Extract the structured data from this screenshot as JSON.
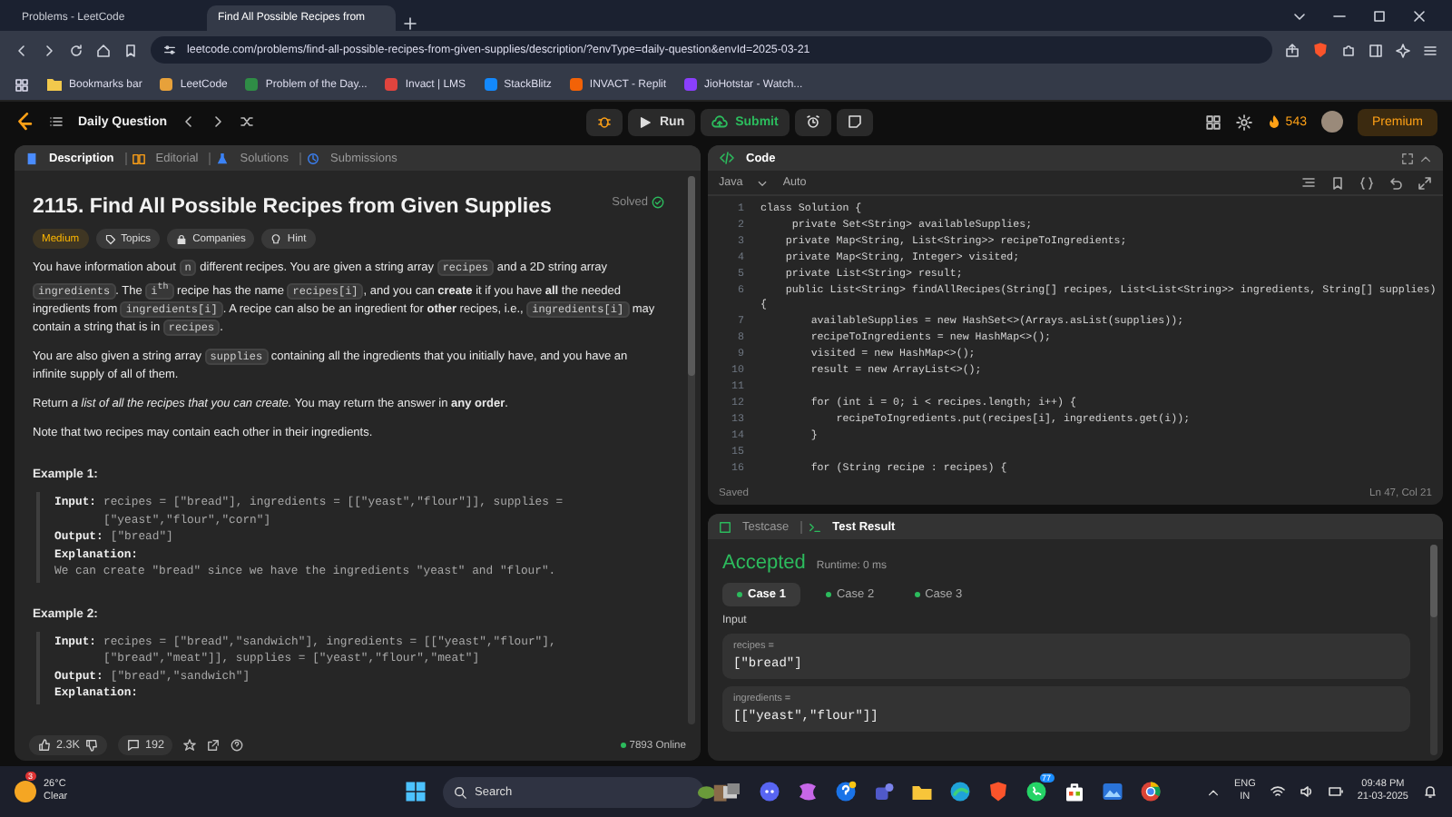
{
  "browser": {
    "tabs": [
      {
        "title": "Problems - LeetCode",
        "selected": false
      },
      {
        "title": "Find All Possible Recipes from",
        "selected": true
      }
    ],
    "url": "leetcode.com/problems/find-all-possible-recipes-from-given-supplies/description/?envType=daily-question&envId=2025-03-21",
    "bookmarks": [
      {
        "label": "Bookmarks bar",
        "kind": "folder",
        "color": "#f2c94c"
      },
      {
        "label": "LeetCode",
        "kind": "site",
        "color": "#e7a13a"
      },
      {
        "label": "Problem of the Day...",
        "kind": "site",
        "color": "#2f8d46"
      },
      {
        "label": "Invact | LMS",
        "kind": "site",
        "color": "#e0443e"
      },
      {
        "label": "StackBlitz",
        "kind": "site",
        "color": "#1389fd"
      },
      {
        "label": "INVACT - Replit",
        "kind": "site",
        "color": "#f26207"
      },
      {
        "label": "JioHotstar - Watch...",
        "kind": "site",
        "color": "#8a3ffc"
      }
    ]
  },
  "header": {
    "title": "Daily Question",
    "run": "Run",
    "submit": "Submit",
    "streak": "543",
    "premium": "Premium"
  },
  "description": {
    "tabs": [
      {
        "label": "Description",
        "selected": true
      },
      {
        "label": "Editorial",
        "selected": false
      },
      {
        "label": "Solutions",
        "selected": false
      },
      {
        "label": "Submissions",
        "selected": false
      }
    ],
    "title": "2115. Find All Possible Recipes from Given Supplies",
    "status": "Solved",
    "tags": [
      {
        "label": "Medium",
        "kind": "difficulty"
      },
      {
        "label": "Topics",
        "kind": "topics"
      },
      {
        "label": "Companies",
        "kind": "companies"
      },
      {
        "label": "Hint",
        "kind": "hint"
      }
    ],
    "paragraphs": [
      [
        {
          "kind": "text",
          "text": "You have information about "
        },
        {
          "kind": "code",
          "text": "n"
        },
        {
          "kind": "text",
          "text": " different recipes. You are given a string array "
        },
        {
          "kind": "code",
          "text": "recipes"
        },
        {
          "kind": "text",
          "text": " and a 2D string array "
        },
        {
          "kind": "code",
          "text": "ingredients"
        },
        {
          "kind": "text",
          "text": ". The "
        },
        {
          "kind": "code",
          "text": "i$^{th}$"
        },
        {
          "kind": "text",
          "text": " recipe has the name "
        },
        {
          "kind": "code",
          "text": "recipes[i]"
        },
        {
          "kind": "text",
          "text": ", and you can **create** it if you have **all** the needed ingredients from "
        },
        {
          "kind": "code",
          "text": "ingredients[i]"
        },
        {
          "kind": "text",
          "text": ". A recipe can also be an ingredient for **other** recipes, i.e., "
        },
        {
          "kind": "code",
          "text": "ingredients[i]"
        },
        {
          "kind": "text",
          "text": " may contain a string that is in "
        },
        {
          "kind": "code",
          "text": "recipes"
        },
        {
          "kind": "text",
          "text": "."
        }
      ],
      [
        {
          "kind": "text",
          "text": "You are also given a string array "
        },
        {
          "kind": "code",
          "text": "supplies"
        },
        {
          "kind": "text",
          "text": " containing all the ingredients that you initially have, and you have an infinite supply of all of them."
        }
      ],
      [
        {
          "kind": "text",
          "text": "Return *a list of all the recipes that you can create.* You may return the answer in **any order**."
        }
      ],
      [
        {
          "kind": "text",
          "text": "Note that two recipes may contain each other in their ingredients."
        }
      ]
    ],
    "examples": [
      {
        "title": "Example 1:",
        "fields": [
          {
            "label": "Input:",
            "kind": "inline",
            "value": "recipes = [\"bread\"], ingredients = [[\"yeast\",\"flour\"]], supplies = [\"yeast\",\"flour\",\"corn\"]"
          },
          {
            "label": "Output:",
            "kind": "inline",
            "value": "[\"bread\"]"
          },
          {
            "label": "Explanation:",
            "kind": "below",
            "value": "We can create \"bread\" since we have the ingredients \"yeast\" and \"flour\"."
          }
        ]
      },
      {
        "title": "Example 2:",
        "fields": [
          {
            "label": "Input:",
            "kind": "inline",
            "value": "recipes = [\"bread\",\"sandwich\"], ingredients = [[\"yeast\",\"flour\"], [\"bread\",\"meat\"]], supplies = [\"yeast\",\"flour\",\"meat\"]"
          },
          {
            "label": "Output:",
            "kind": "inline",
            "value": "[\"bread\",\"sandwich\"]"
          },
          {
            "label": "Explanation:",
            "kind": "below"
          }
        ]
      }
    ],
    "footer": {
      "likes": "2.3K",
      "comments": "192",
      "online": "7893 Online"
    }
  },
  "code": {
    "title": "Code",
    "language": "Java",
    "mode": "Auto",
    "lines": [
      {
        "number": "1",
        "text": "class Solution {"
      },
      {
        "number": "2",
        "text": "     private Set<String> availableSupplies;"
      },
      {
        "number": "3",
        "text": "    private Map<String, List<String>> recipeToIngredients;"
      },
      {
        "number": "4",
        "text": "    private Map<String, Integer> visited;"
      },
      {
        "number": "5",
        "text": "    private List<String> result;"
      },
      {
        "number": "6",
        "text": "    public List<String> findAllRecipes(String[] recipes, List<List<String>> ingredients, String[] supplies)",
        "wrap": "{"
      },
      {
        "number": "7",
        "text": "        availableSupplies = new HashSet<>(Arrays.asList(supplies));"
      },
      {
        "number": "8",
        "text": "        recipeToIngredients = new HashMap<>();"
      },
      {
        "number": "9",
        "text": "        visited = new HashMap<>();"
      },
      {
        "number": "10",
        "text": "        result = new ArrayList<>();"
      },
      {
        "number": "11"
      },
      {
        "number": "12",
        "text": "        for (int i = 0; i < recipes.length; i++) {"
      },
      {
        "number": "13",
        "text": "            recipeToIngredients.put(recipes[i], ingredients.get(i));"
      },
      {
        "number": "14",
        "text": "        }"
      },
      {
        "number": "15"
      },
      {
        "number": "16",
        "text": "        for (String recipe : recipes) {"
      }
    ],
    "status": "Saved",
    "cursor": "Ln 47, Col 21"
  },
  "test": {
    "tabs": [
      {
        "label": "Testcase",
        "selected": false
      },
      {
        "label": "Test Result",
        "selected": true
      }
    ],
    "verdict": "Accepted",
    "runtime": "Runtime: 0 ms",
    "cases": [
      {
        "label": "Case 1",
        "selected": true
      },
      {
        "label": "Case 2",
        "selected": false
      },
      {
        "label": "Case 3",
        "selected": false
      }
    ],
    "input_label": "Input",
    "params": [
      {
        "name": "recipes =",
        "value": "[\"bread\"]"
      },
      {
        "name": "ingredients =",
        "value": "[[\"yeast\",\"flour\"]]"
      }
    ]
  },
  "taskbar": {
    "weather": {
      "temp": "26°C",
      "condition": "Clear",
      "badge": "3"
    },
    "search_placeholder": "Search",
    "apps": [
      {
        "kind": "taskview"
      },
      {
        "kind": "chat"
      },
      {
        "kind": "copilot"
      },
      {
        "kind": "help"
      },
      {
        "kind": "people"
      },
      {
        "kind": "folder"
      },
      {
        "kind": "browser"
      },
      {
        "kind": "shield"
      },
      {
        "kind": "phone",
        "badge": "77"
      },
      {
        "kind": "bag"
      },
      {
        "kind": "photos"
      },
      {
        "kind": "circle"
      }
    ],
    "tray": {
      "lang": "ENG",
      "region": "IN",
      "time": "09:48 PM",
      "date": "21-03-2025"
    }
  }
}
